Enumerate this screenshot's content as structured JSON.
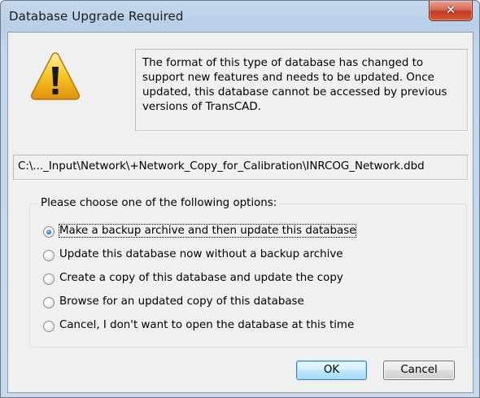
{
  "window": {
    "title": "Database Upgrade Required",
    "close_symbol": "✕"
  },
  "icons": {
    "warning": "warning-icon",
    "close": "close-icon"
  },
  "message": "The format of this type of database has changed to support new features and needs to be updated. Once updated, this database cannot be accessed by previous versions of TransCAD.",
  "path": "C:\\..._Input\\Network\\+Network_Copy_for_Calibration\\INRCOG_Network.dbd",
  "options_group": {
    "label": "Please choose one of the following options:",
    "options": [
      {
        "label": "Make a backup archive and then update this database",
        "checked": true
      },
      {
        "label": "Update this database now without a backup archive",
        "checked": false
      },
      {
        "label": "Create a copy of this database and update the copy",
        "checked": false
      },
      {
        "label": "Browse for an updated copy of this database",
        "checked": false
      },
      {
        "label": "Cancel, I don't want to open the database at this time",
        "checked": false
      }
    ]
  },
  "buttons": {
    "ok": "OK",
    "cancel": "Cancel"
  }
}
